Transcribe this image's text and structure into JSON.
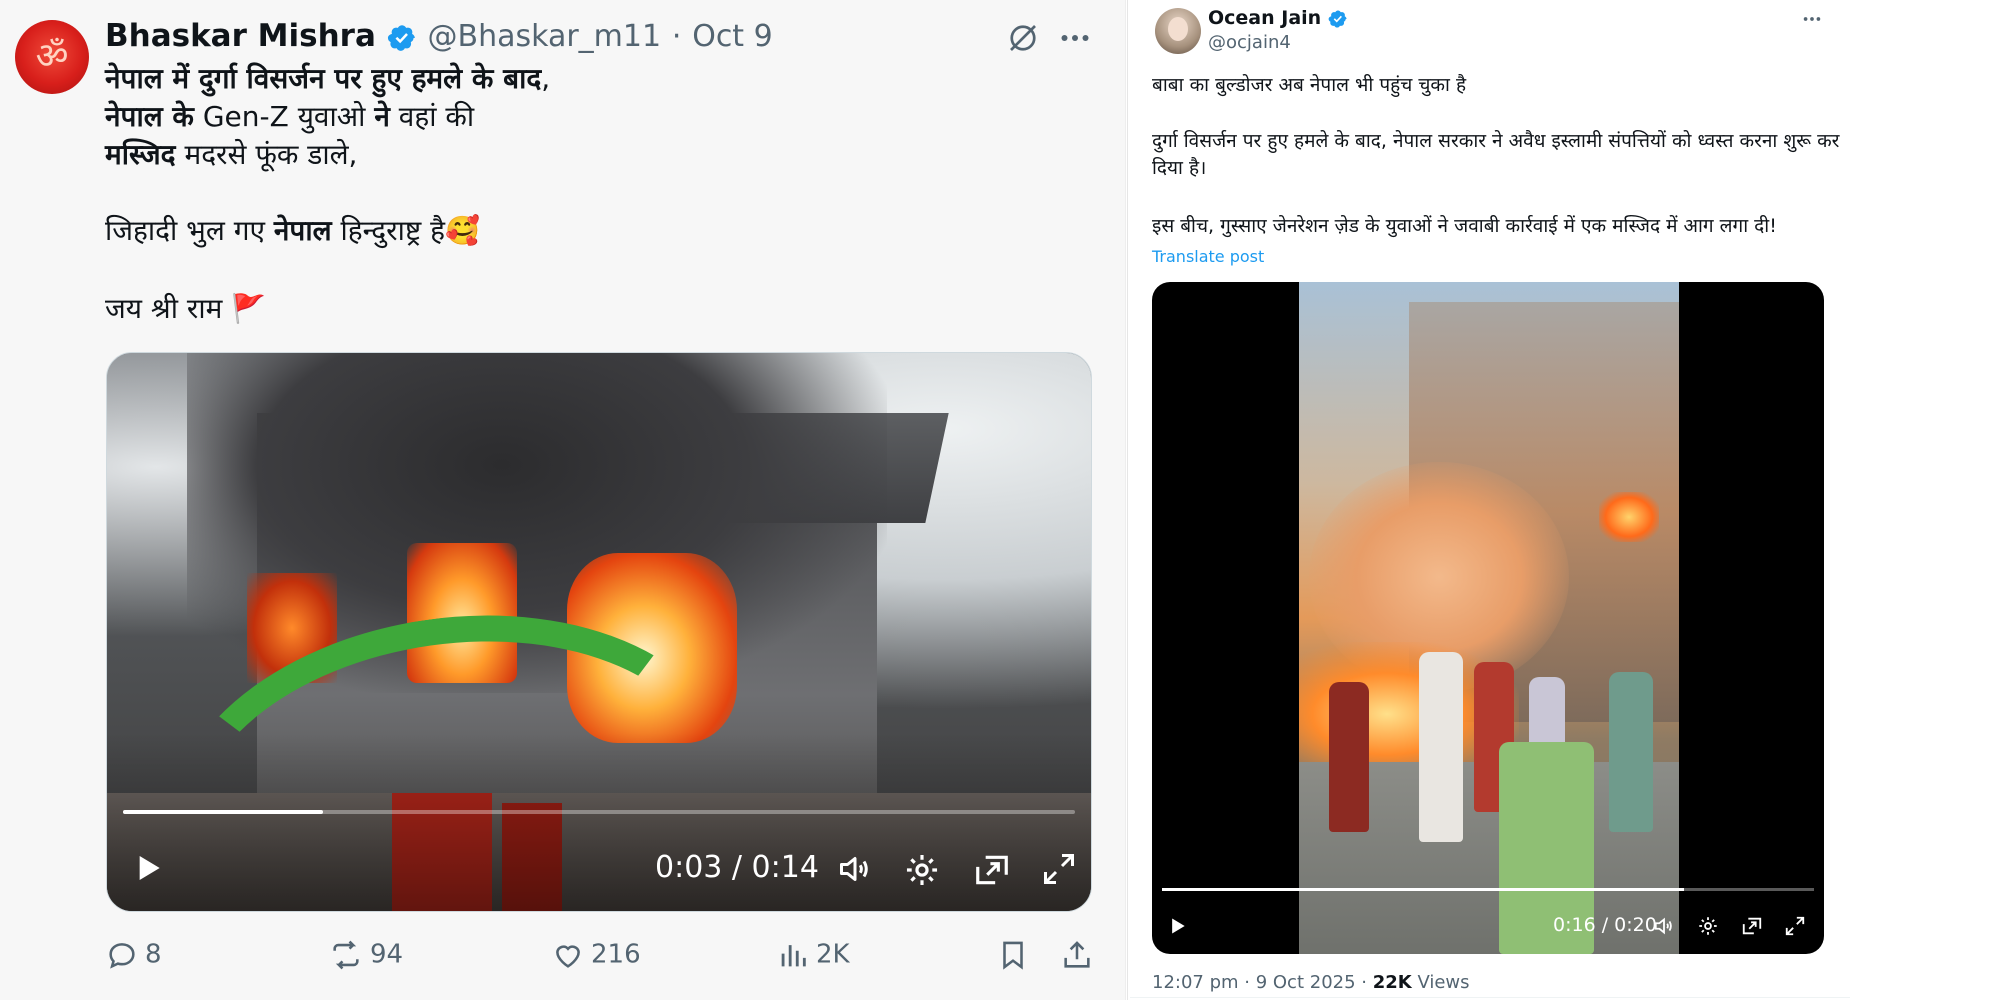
{
  "left_tweet": {
    "author": {
      "name": "Bhaskar Mishra",
      "handle": "@Bhaskar_m11",
      "separator": "·",
      "date": "Oct 9",
      "avatar_glyph": "ॐ"
    },
    "body": {
      "line1_bold": "नेपाल में दुर्गा विसर्जन पर हुए हमले के बाद",
      "line1_tail": ",",
      "line2_bold_a": "नेपाल के",
      "line2_text_a": " Gen-Z युवाओ ",
      "line2_bold_b": "ने",
      "line2_text_b": " वहां की",
      "line3_bold": "मस्जिद",
      "line3_text": " मदरसे फूंक डाले,",
      "line4_text_a": "जिहादी भुल गए ",
      "line4_bold": "नेपाल",
      "line4_text_b": " हिन्दुराष्ट्र है🥰",
      "line5_text": "जय श्री राम 🚩"
    },
    "video": {
      "time": "0:03 / 0:14",
      "progress": 0.21
    },
    "actions": {
      "replies": "8",
      "reposts": "94",
      "likes": "216",
      "views": "2K"
    }
  },
  "right_tweet": {
    "author": {
      "name": "Ocean Jain",
      "handle": "@ocjain4"
    },
    "body": {
      "para1": "बाबा का बुल्डोजर अब नेपाल भी पहुंच चुका है",
      "para2": "दुर्गा विसर्जन पर हुए हमले के बाद, नेपाल सरकार ने अवैध इस्लामी संपत्तियों को ध्वस्त करना शुरू कर दिया है।",
      "para3": "इस बीच, गुस्साए जेनरेशन ज़ेड के युवाओं ने जवाबी कार्रवाई में एक मस्जिद में आग लगा दी!"
    },
    "translate_label": "Translate post",
    "video": {
      "time": "0:16 / 0:20",
      "progress": 0.8
    },
    "footer": {
      "timestamp": "12:07 pm · 9 Oct 2025",
      "separator": " · ",
      "views_count": "22K",
      "views_label": " Views"
    }
  },
  "colors": {
    "text": "#0f1419",
    "muted": "#536471",
    "link": "#1d9bf0",
    "verified": "#1d9bf0"
  },
  "icons": [
    "verified-badge-icon",
    "grok-icon",
    "more-icon",
    "play-icon",
    "volume-icon",
    "settings-icon",
    "pip-icon",
    "fullscreen-icon",
    "reply-icon",
    "repost-icon",
    "like-icon",
    "views-icon",
    "bookmark-icon",
    "share-icon"
  ]
}
